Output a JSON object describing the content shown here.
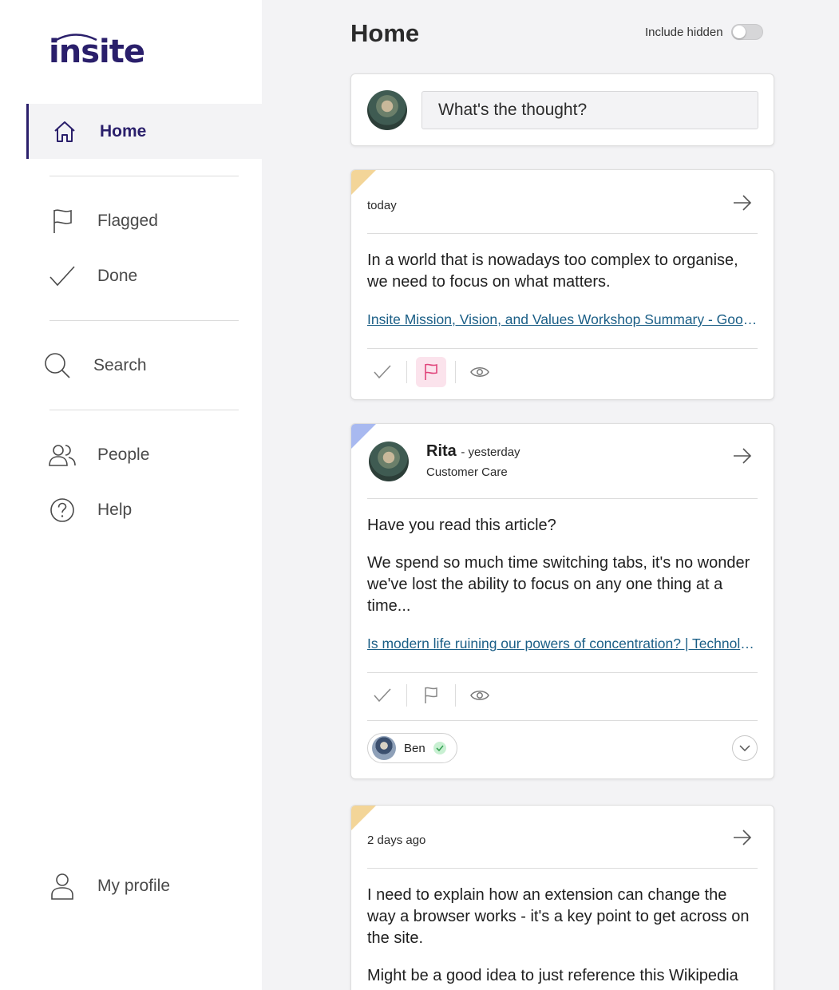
{
  "app": {
    "logo_text": "insite"
  },
  "sidebar": {
    "items": [
      {
        "label": "Home",
        "icon": "home-icon",
        "active": true
      },
      {
        "label": "Flagged",
        "icon": "flag-icon"
      },
      {
        "label": "Done",
        "icon": "check-icon"
      },
      {
        "label": "Search",
        "icon": "search-icon"
      },
      {
        "label": "People",
        "icon": "people-icon"
      },
      {
        "label": "Help",
        "icon": "help-icon"
      },
      {
        "label": "My profile",
        "icon": "user-icon"
      }
    ]
  },
  "header": {
    "title": "Home",
    "toggle_label": "Include hidden",
    "toggle_on": false
  },
  "composer": {
    "placeholder": "What's the thought?"
  },
  "posts": [
    {
      "corner_color": "#f3d598",
      "when": "today",
      "text": "In a world that is nowadays too complex to organise, we need to focus on what matters.",
      "link": "Insite Mission, Vision, and Values Workshop Summary - Google Docs",
      "flagged": true
    },
    {
      "corner_color": "#a8b9f0",
      "author": "Rita",
      "when": "- yesterday",
      "team": "Customer Care",
      "text_1": "Have you read this article?",
      "text_2": "We spend so much time switching tabs, it's no wonder we've lost the ability to focus on any one thing at a time...",
      "link": "Is modern life ruining our powers of concentration? | Technology | The Guardian",
      "flagged": false,
      "people": [
        {
          "name": "Ben",
          "done": true
        }
      ]
    },
    {
      "corner_color": "#f3d598",
      "when": "2 days ago",
      "text_1": "I need to explain how an extension can change the way a browser works - it's a key point to get across on the site.",
      "text_2": "Might be a good idea to just reference this Wikipedia"
    }
  ],
  "colors": {
    "brand": "#2a1f6b",
    "link": "#1a5e86",
    "flag_active": "#e0457b",
    "flag_active_bg": "#fbe3ec",
    "done_check": "#3aa357"
  }
}
